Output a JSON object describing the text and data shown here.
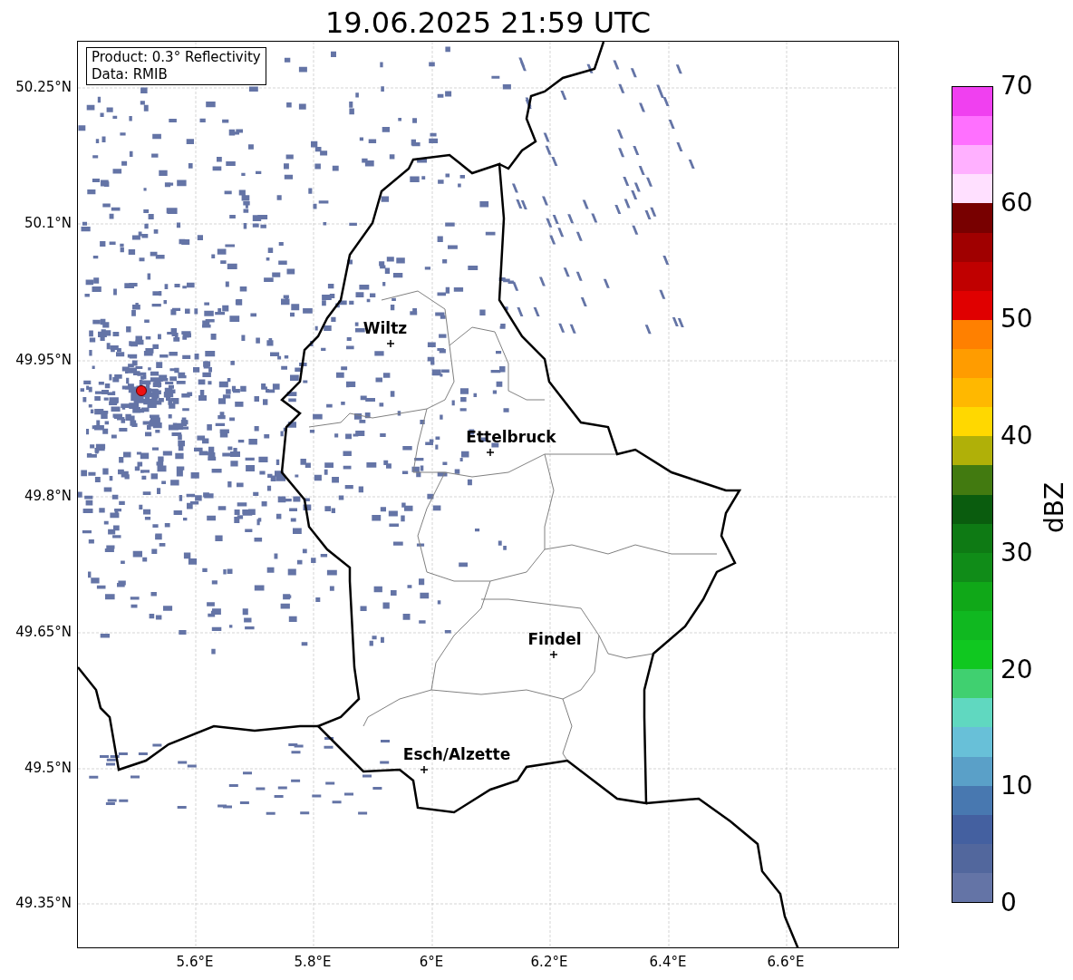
{
  "title": "19.06.2025 21:59 UTC",
  "info_box": {
    "lines": [
      "Product: 0.3° Reflectivity",
      "Data: RMIB"
    ]
  },
  "y_ticks": [
    "50.25°N",
    "50.1°N",
    "49.95°N",
    "49.8°N",
    "49.65°N",
    "49.5°N",
    "49.35°N"
  ],
  "x_ticks": [
    "5.6°E",
    "5.8°E",
    "6°E",
    "6.2°E",
    "6.4°E",
    "6.6°E"
  ],
  "cities": [
    {
      "name": "Wiltz"
    },
    {
      "name": "Ettelbruck"
    },
    {
      "name": "Findel"
    },
    {
      "name": "Esch/Alzette"
    }
  ],
  "colorbar": {
    "label": "dBZ",
    "ticks": [
      "70",
      "60",
      "50",
      "40",
      "30",
      "20",
      "10",
      "0"
    ],
    "segments": [
      {
        "color": "#f040f0"
      },
      {
        "color": "#ff70ff"
      },
      {
        "color": "#ffb0ff"
      },
      {
        "color": "#ffe0ff"
      },
      {
        "color": "#780000"
      },
      {
        "color": "#a00000"
      },
      {
        "color": "#c00000"
      },
      {
        "color": "#e00000"
      },
      {
        "color": "#ff8000"
      },
      {
        "color": "#ff9c00"
      },
      {
        "color": "#ffb800"
      },
      {
        "color": "#ffd800"
      },
      {
        "color": "#b0b008"
      },
      {
        "color": "#427a10"
      },
      {
        "color": "#0a5c0e"
      },
      {
        "color": "#0e7a14"
      },
      {
        "color": "#108c18"
      },
      {
        "color": "#10a818"
      },
      {
        "color": "#10b820"
      },
      {
        "color": "#10c820"
      },
      {
        "color": "#40d070"
      },
      {
        "color": "#60d8c0"
      },
      {
        "color": "#68c0d8"
      },
      {
        "color": "#5aa0c8"
      },
      {
        "color": "#4878b0"
      },
      {
        "color": "#4460a0"
      },
      {
        "color": "#52679d"
      },
      {
        "color": "#6474a6"
      }
    ]
  }
}
